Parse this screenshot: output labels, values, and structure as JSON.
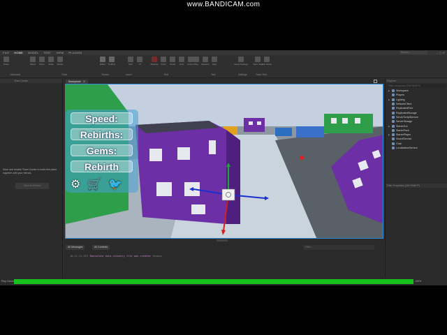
{
  "watermark": "www.BANDICAM.com",
  "menubar": {
    "tabs": [
      "FILE",
      "HOME",
      "MODEL",
      "TEST",
      "VIEW",
      "PLUGINS"
    ],
    "active_tab": "HOME",
    "search_placeholder": "Search..."
  },
  "ribbon": {
    "clipboard_label": "Clipboard",
    "tools_label": "Tools",
    "terrain_label": "Terrain",
    "insert_label": "Insert",
    "edit_label": "Edit",
    "test_label": "Test",
    "settings_label": "Settings",
    "team_test_label": "Team Test",
    "buttons": [
      {
        "label": "Paste",
        "icon": "paste-icon"
      },
      {
        "label": "Select",
        "icon": "cursor-icon"
      },
      {
        "label": "Move",
        "icon": "move-icon"
      },
      {
        "label": "Scale",
        "icon": "scale-icon"
      },
      {
        "label": "Rotate",
        "icon": "rotate-icon"
      },
      {
        "label": "Editor",
        "icon": "terrain-icon"
      },
      {
        "label": "Toolbox",
        "icon": "toolbox-icon"
      },
      {
        "label": "Part",
        "icon": "part-icon"
      },
      {
        "label": "UI",
        "icon": "ui-icon"
      },
      {
        "label": "Material",
        "icon": "material-icon"
      },
      {
        "label": "Color",
        "icon": "color-icon"
      },
      {
        "label": "Group",
        "icon": "group-icon"
      },
      {
        "label": "Lock",
        "icon": "lock-icon"
      },
      {
        "label": "Anchor",
        "icon": "anchor-icon"
      },
      {
        "label": "Play",
        "icon": "play-icon"
      },
      {
        "label": "Resume",
        "icon": "resume-icon"
      },
      {
        "label": "Stop",
        "icon": "stop-icon"
      },
      {
        "label": "Game Settings",
        "icon": "settings-icon"
      },
      {
        "label": "Team Test",
        "icon": "team-test-icon"
      },
      {
        "label": "Exit Game",
        "icon": "exit-icon"
      }
    ]
  },
  "left_panel": {
    "title": "Team Create",
    "message": "Save and enable Team Create to build this place together with your friends.",
    "button_label": "Save to Roblox"
  },
  "viewport": {
    "tab_label": "Baseplate",
    "hud": {
      "speed_label": "Speed:",
      "rebirths_label": "Rebirths:",
      "gems_label": "Gems:",
      "rebirth_button": "Rebirth",
      "icons": [
        "gear-icon",
        "cart-icon",
        "twitter-icon"
      ]
    }
  },
  "output": {
    "filters": [
      "All Messages",
      "All Contexts"
    ],
    "filter_placeholder": "Filter...",
    "lines": [
      {
        "time": "10:11:11.513",
        "text": "Baseplate auto-recovery file was created",
        "source": "Studio"
      }
    ]
  },
  "explorer": {
    "title": "Explorer",
    "search_placeholder": "Filter workspace (Ctrl+Shift+X)",
    "items": [
      "Workspace",
      "Players",
      "Lighting",
      "NetworkClient",
      "ReplicatedFirst",
      "ReplicatedStorage",
      "ServerScriptService",
      "ServerStorage",
      "StarterGui",
      "StarterPack",
      "StarterPlayer",
      "SoundService",
      "Chat",
      "LocalizationService"
    ]
  },
  "properties": {
    "title": "Properties",
    "search_placeholder": "Filter Properties (Ctrl+Shift+P)"
  },
  "status": {
    "label": "Play Game",
    "progress_pct": "100%",
    "progress": 1.0,
    "progress_color": "#18c21e"
  },
  "colors": {
    "accent": "#2e8bd6",
    "building_purple": "#6c2fa6",
    "sky": "#b9c6d9"
  }
}
